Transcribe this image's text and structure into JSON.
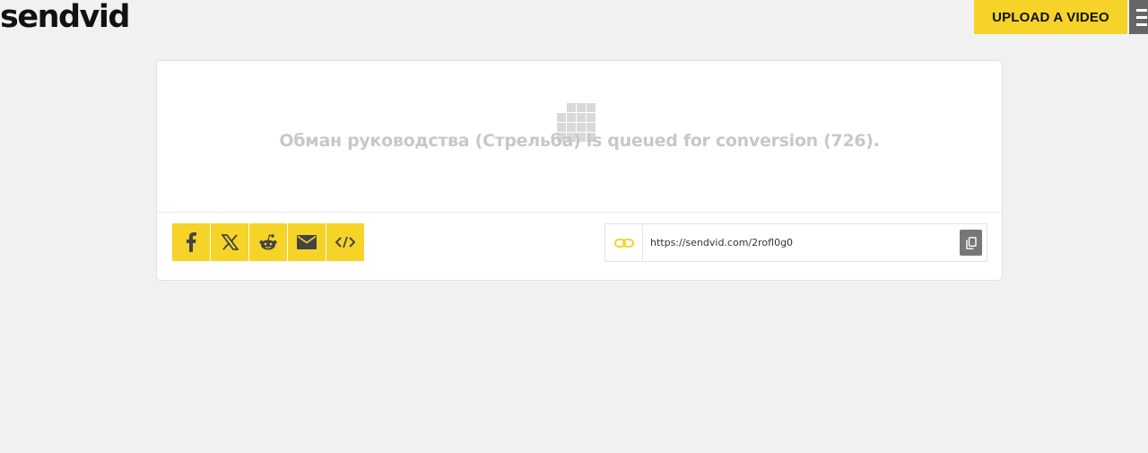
{
  "header": {
    "logo": "sendvid",
    "upload_label": "UPLOAD A VIDEO"
  },
  "status": {
    "message": "Обман руководства (Стрельба) is queued for conversion (726)."
  },
  "share": {
    "buttons": [
      "facebook-icon",
      "x-icon",
      "reddit-icon",
      "email-icon",
      "embed-code-icon"
    ]
  },
  "link": {
    "url": "https://sendvid.com/2rofl0g0"
  },
  "colors": {
    "accent": "#f5d328",
    "background": "#f1f1f1",
    "menu": "#666666"
  }
}
